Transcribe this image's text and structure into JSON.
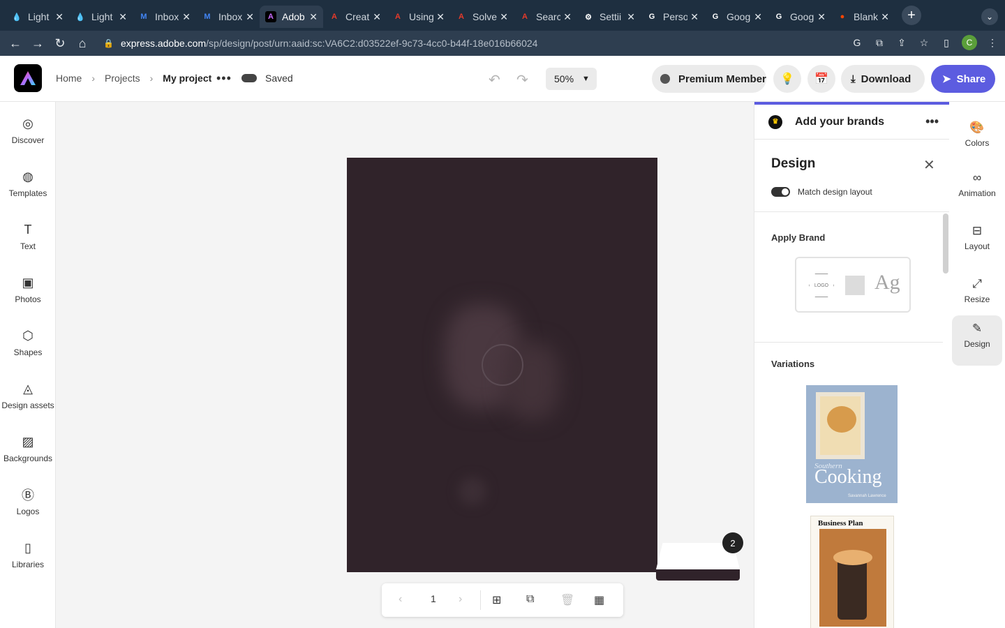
{
  "browser": {
    "tabs": [
      {
        "label": "Light",
        "favicon": "drop-icon",
        "color": "#e04040"
      },
      {
        "label": "Light",
        "favicon": "drop-icon",
        "color": "#e04040"
      },
      {
        "label": "Inbox",
        "favicon": "mail-icon",
        "color": "#4285f4"
      },
      {
        "label": "Inbox",
        "favicon": "mail-icon",
        "color": "#4285f4"
      },
      {
        "label": "Adob",
        "favicon": "adobe-express-icon",
        "color": "#000000",
        "active": true
      },
      {
        "label": "Creat",
        "favicon": "adobe-icon",
        "color": "#e63a2a"
      },
      {
        "label": "Using",
        "favicon": "adobe-icon",
        "color": "#e63a2a"
      },
      {
        "label": "Solve",
        "favicon": "adobe-icon",
        "color": "#e63a2a"
      },
      {
        "label": "Searc",
        "favicon": "adobe-icon",
        "color": "#e63a2a"
      },
      {
        "label": "Settii",
        "favicon": "gear-icon",
        "color": "#ffffff"
      },
      {
        "label": "Perso",
        "favicon": "google-icon",
        "color": "#ffffff"
      },
      {
        "label": "Goog",
        "favicon": "google-icon",
        "color": "#ffffff"
      },
      {
        "label": "Goog",
        "favicon": "google-icon",
        "color": "#ffffff"
      },
      {
        "label": "Blank",
        "favicon": "reddit-icon",
        "color": "#ff4500"
      }
    ],
    "url_host": "express.adobe.com",
    "url_path": "/sp/design/post/urn:aaid:sc:VA6C2:d03522ef-9c73-4cc0-b44f-18e016b66024",
    "profile_initial": "C"
  },
  "header": {
    "breadcrumb": [
      "Home",
      "Projects",
      "My project"
    ],
    "saved_label": "Saved",
    "zoom": "50%",
    "premium_label": "Premium Member",
    "download_label": "Download",
    "share_label": "Share",
    "accent": "#5c5ce0"
  },
  "left_rail": [
    {
      "label": "Discover",
      "icon": "compass-icon"
    },
    {
      "label": "Templates",
      "icon": "templates-icon"
    },
    {
      "label": "Text",
      "icon": "text-icon"
    },
    {
      "label": "Photos",
      "icon": "photo-icon"
    },
    {
      "label": "Shapes",
      "icon": "shapes-icon"
    },
    {
      "label": "Design assets",
      "icon": "design-assets-icon"
    },
    {
      "label": "Backgrounds",
      "icon": "backgrounds-icon"
    },
    {
      "label": "Logos",
      "icon": "logo-icon"
    },
    {
      "label": "Libraries",
      "icon": "library-icon"
    }
  ],
  "canvas": {
    "artboard_color": "#30232a",
    "page_number": "1",
    "page_count_badge": "2"
  },
  "panel": {
    "brand_title": "Add your brands",
    "design_title": "Design",
    "match_layout_label": "Match design layout",
    "match_layout_on": true,
    "apply_brand_title": "Apply Brand",
    "logo_placeholder": "LOGO",
    "type_sample": "Ag",
    "variations_title": "Variations",
    "variations": [
      {
        "subtitle": "Southern",
        "title": "Cooking",
        "author": "Savannah Lawrence"
      },
      {
        "title": "Business Plan"
      }
    ]
  },
  "right_rail": [
    {
      "label": "Colors",
      "icon": "palette-icon"
    },
    {
      "label": "Animation",
      "icon": "animation-icon"
    },
    {
      "label": "Layout",
      "icon": "layout-icon"
    },
    {
      "label": "Resize",
      "icon": "resize-icon"
    },
    {
      "label": "Design",
      "icon": "magic-wand-icon",
      "active": true
    }
  ]
}
